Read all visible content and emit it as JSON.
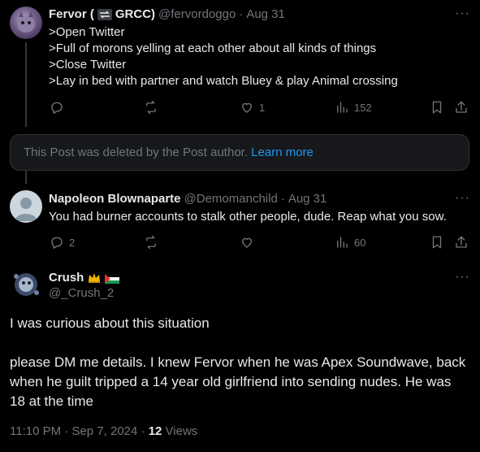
{
  "post1": {
    "author_name": "Fervor (",
    "author_name_tail": "GRCC)",
    "handle": "@fervordoggo",
    "sep": "·",
    "date": "Aug 31",
    "lines": [
      ">Open Twitter",
      ">Full of morons yelling at each other about all kinds of things",
      ">Close Twitter",
      ">Lay in bed with partner and watch Bluey & play Animal crossing"
    ],
    "likes": "1",
    "views": "152"
  },
  "deleted": {
    "text": "This Post was deleted by the Post author.",
    "link": "Learn more"
  },
  "post2": {
    "author_name": "Napoleon Blownaparte",
    "handle": "@Demomanchild",
    "sep": "·",
    "date": "Aug 31",
    "text": "You had burner accounts to stalk other people, dude. Reap what you sow.",
    "replies": "2",
    "views": "60"
  },
  "main": {
    "author_name": "Crush",
    "handle": "@_Crush_2",
    "para1": "I was curious about this situation",
    "para2": "please DM me details. I knew Fervor when he was Apex Soundwave, back when he guilt tripped a 14 year old girlfriend into sending nudes. He was 18 at the time",
    "time": "11:10 PM",
    "sep": "·",
    "date": "Sep 7, 2024",
    "sep2": "·",
    "views_count": "12",
    "views_label": "Views"
  },
  "more_label": "···",
  "colors": {
    "background": "#000000",
    "text": "#e7e9ea",
    "muted": "#71767b",
    "link": "#1d9bf0",
    "card": "#16181c"
  }
}
